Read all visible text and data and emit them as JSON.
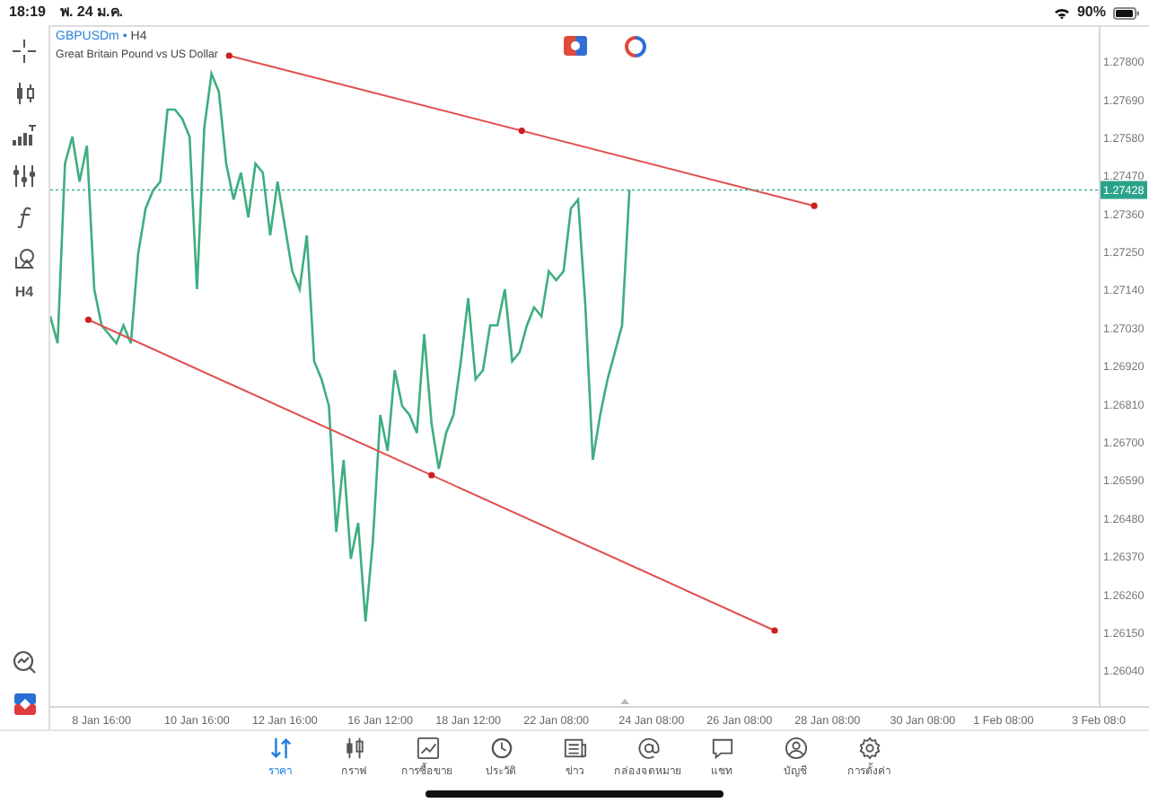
{
  "status_bar": {
    "time": "18:19",
    "date": "พ. 24 ม.ค.",
    "battery": "90%"
  },
  "toolbar": {
    "timeframe": "H4"
  },
  "chart": {
    "symbol": "GBPUSDm",
    "separator": "•",
    "timeframe": "H4",
    "description": "Great Britain Pound vs US Dollar",
    "drawings": [
      {
        "kind": "trendline"
      },
      {
        "kind": "trendline"
      }
    ],
    "chart_data": {
      "type": "line",
      "categories": [
        null,
        null,
        null,
        null,
        null,
        null,
        null,
        "8 Jan 16:00",
        null,
        null,
        null,
        null,
        null,
        null,
        null,
        null,
        null,
        null,
        null,
        null,
        "10 Jan 16:00",
        null,
        null,
        null,
        null,
        null,
        null,
        null,
        null,
        null,
        null,
        null,
        "12 Jan 16:00",
        null,
        null,
        null,
        null,
        null,
        null,
        null,
        null,
        null,
        null,
        null,
        null,
        "16 Jan 12:00",
        null,
        null,
        null,
        null,
        null,
        null,
        null,
        null,
        null,
        null,
        null,
        "18 Jan 12:00",
        null,
        null,
        null,
        null,
        null,
        null,
        null,
        null,
        null,
        null,
        null,
        "22 Jan 08:00",
        null,
        null,
        null,
        null,
        null,
        null,
        null,
        null,
        null,
        null,
        null,
        null,
        "24 Jan 08:00",
        null,
        null,
        null,
        null,
        null,
        null,
        null,
        null,
        null,
        null,
        null,
        "26 Jan 08:00",
        null,
        null,
        null,
        null,
        null,
        null,
        null,
        null,
        null,
        null,
        null,
        "28 Jan 08:00",
        null,
        null,
        null,
        null,
        null,
        null,
        null,
        null,
        null,
        null,
        null,
        null,
        "30 Jan 08:00",
        null,
        null,
        null,
        null,
        null,
        null,
        null,
        null,
        null,
        null,
        "1 Feb 08:00",
        null,
        null,
        null,
        null,
        null,
        null,
        null,
        null,
        null,
        null,
        null,
        null,
        "3 Feb 08:0"
      ],
      "series": [
        {
          "color": "#3dae7f",
          "values": [
            1.27063,
            1.26985,
            1.27504,
            1.27582,
            1.27452,
            1.27556,
            1.27141,
            1.27037,
            1.27011,
            1.26985,
            1.27037,
            1.26985,
            1.27245,
            1.27374,
            1.27426,
            1.27452,
            1.2766,
            1.2766,
            1.27634,
            1.27582,
            1.27141,
            1.27608,
            1.27764,
            1.27712,
            1.27504,
            1.274,
            1.27478,
            1.27349,
            1.27504,
            1.27478,
            1.27297,
            1.27452,
            1.27323,
            1.27193,
            1.27141,
            1.27297,
            1.26933,
            1.26881,
            1.26804,
            1.2644,
            1.26648,
            1.26362,
            1.26466,
            1.26181,
            1.26414,
            1.26778,
            1.26674,
            1.26907,
            1.26804,
            1.26778,
            1.26726,
            1.27011,
            1.26752,
            1.26622,
            1.26726,
            1.26778,
            1.26933,
            1.27115,
            1.26881,
            1.26907,
            1.27037,
            1.27037,
            1.27141,
            1.26933,
            1.26959,
            1.27037,
            1.27089,
            1.27063,
            1.27193,
            1.27167,
            1.27193,
            1.27374,
            1.274,
            1.27089,
            1.26648,
            1.26778,
            1.26881,
            1.26959,
            1.27037,
            1.27428,
            null,
            null,
            null,
            null,
            null,
            null,
            null,
            null,
            null,
            null,
            null,
            null,
            null,
            null,
            null,
            null,
            null,
            null,
            null,
            null,
            null,
            null,
            null,
            null,
            null,
            null,
            null,
            null,
            null,
            null,
            null,
            null,
            null,
            null,
            null,
            null,
            null,
            null,
            null,
            null,
            null,
            null,
            null,
            null,
            null,
            null,
            null,
            null,
            null,
            null,
            null,
            null,
            null,
            null,
            null,
            null,
            null,
            null,
            null,
            null,
            null,
            null,
            null,
            null
          ]
        }
      ],
      "ylim": [
        1.25937,
        1.27899
      ],
      "yticks": [
        {
          "value": 1.278,
          "label": "1.27800"
        },
        {
          "value": 1.2769,
          "label": "1.27690"
        },
        {
          "value": 1.2758,
          "label": "1.27580"
        },
        {
          "value": 1.2747,
          "label": "1.27470"
        },
        {
          "value": 1.2736,
          "label": "1.27360"
        },
        {
          "value": 1.2725,
          "label": "1.27250"
        },
        {
          "value": 1.2714,
          "label": "1.27140"
        },
        {
          "value": 1.2703,
          "label": "1.27030"
        },
        {
          "value": 1.2692,
          "label": "1.26920"
        },
        {
          "value": 1.2681,
          "label": "1.26810"
        },
        {
          "value": 1.267,
          "label": "1.26700"
        },
        {
          "value": 1.2659,
          "label": "1.26590"
        },
        {
          "value": 1.2648,
          "label": "1.26480"
        },
        {
          "value": 1.2637,
          "label": "1.26370"
        },
        {
          "value": 1.2626,
          "label": "1.26260"
        },
        {
          "value": 1.2615,
          "label": "1.26150"
        },
        {
          "value": 1.2604,
          "label": "1.26040"
        }
      ],
      "ref_lines": [
        {
          "axis": "y",
          "value": 1.27428,
          "label": "1.27428"
        }
      ]
    }
  },
  "tabs": [
    {
      "label": "ราคา",
      "selected": true
    },
    {
      "label": "กราฟ",
      "selected": false
    },
    {
      "label": "การซื้อขาย",
      "selected": false
    },
    {
      "label": "ประวัติ",
      "selected": false
    },
    {
      "label": "ข่าว",
      "selected": false
    },
    {
      "label": "กล่องจดหมาย",
      "selected": false
    },
    {
      "label": "แชท",
      "selected": false
    },
    {
      "label": "บัญชี",
      "selected": false
    },
    {
      "label": "การตั้งค่า",
      "selected": false
    }
  ]
}
